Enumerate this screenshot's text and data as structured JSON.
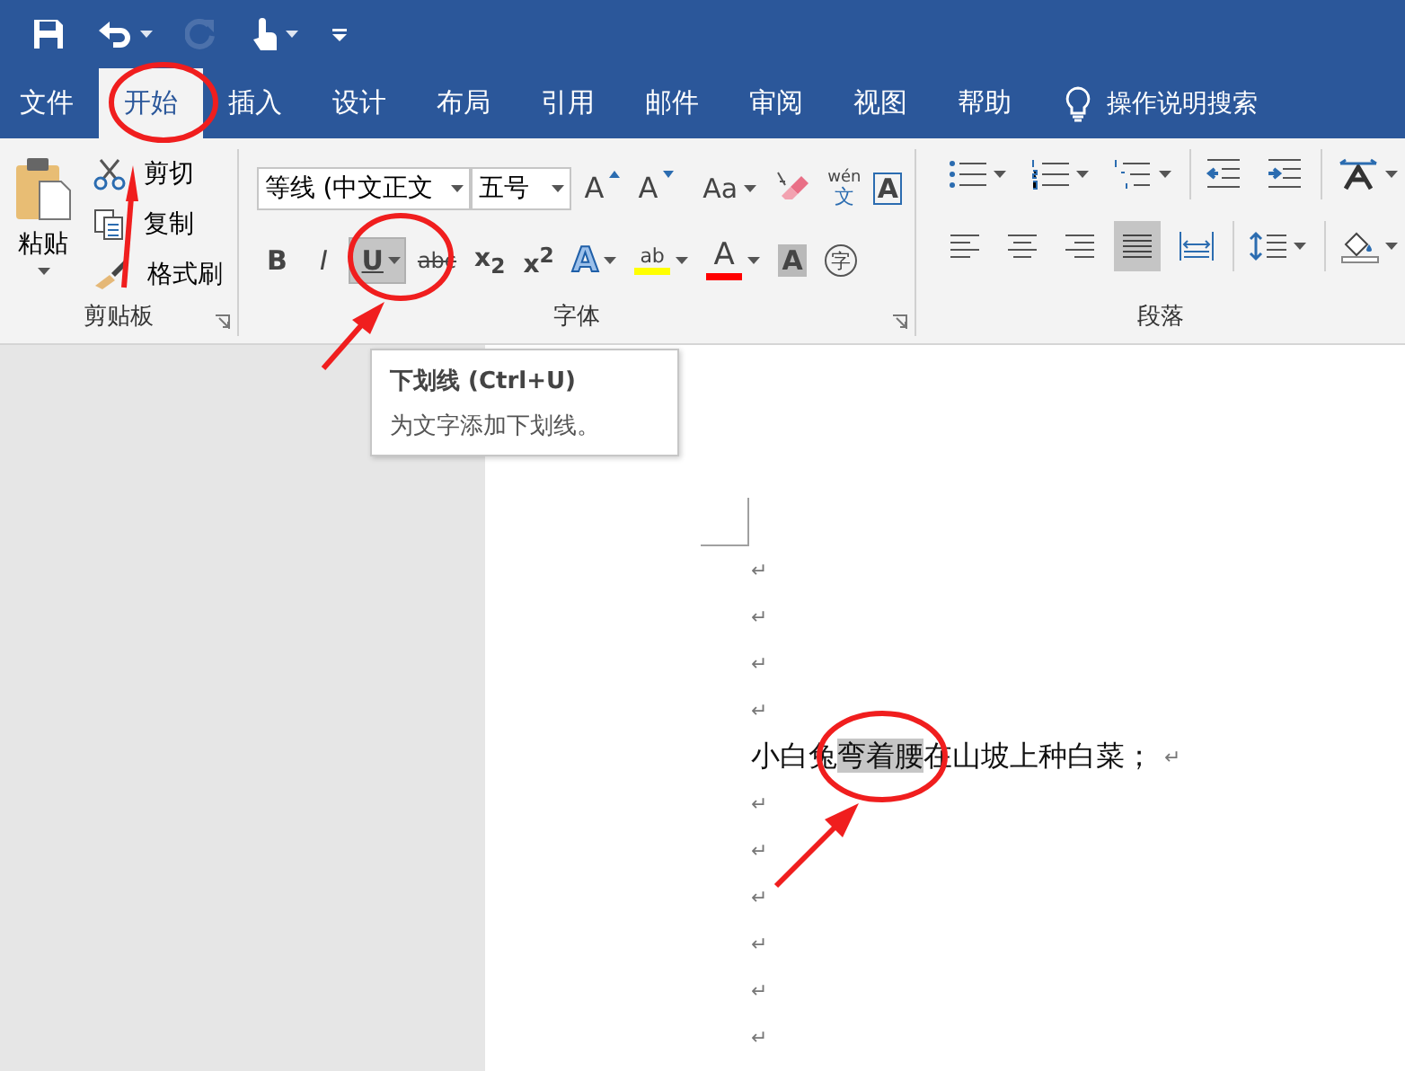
{
  "quick_access": [
    {
      "kind": "save",
      "disabled": false,
      "dropdown": false
    },
    {
      "kind": "undo",
      "disabled": false,
      "dropdown": true
    },
    {
      "kind": "redo",
      "disabled": true,
      "dropdown": false
    },
    {
      "kind": "touch",
      "disabled": false,
      "dropdown": true
    },
    {
      "kind": "customize",
      "disabled": false,
      "dropdown": false
    }
  ],
  "tabs": [
    {
      "label": "文件",
      "selected": false
    },
    {
      "label": "开始",
      "selected": true
    },
    {
      "label": "插入",
      "selected": false
    },
    {
      "label": "设计",
      "selected": false
    },
    {
      "label": "布局",
      "selected": false
    },
    {
      "label": "引用",
      "selected": false
    },
    {
      "label": "邮件",
      "selected": false
    },
    {
      "label": "审阅",
      "selected": false
    },
    {
      "label": "视图",
      "selected": false
    },
    {
      "label": "帮助",
      "selected": false
    }
  ],
  "tell_me": {
    "label": "操作说明搜索"
  },
  "clipboard": {
    "paste": "粘贴",
    "label": "剪贴板",
    "items": [
      {
        "kind": "cut",
        "label": "剪切"
      },
      {
        "kind": "copy",
        "label": "复制"
      },
      {
        "kind": "format-painter",
        "label": "格式刷"
      }
    ]
  },
  "font": {
    "font_name": "等线 (中文正文",
    "font_size": "五号",
    "label": "字体",
    "row1": [
      {
        "kind": "grow",
        "label": "A"
      },
      {
        "kind": "shrink",
        "label": "A"
      },
      {
        "kind": "case",
        "label": "Aa"
      },
      {
        "kind": "clear"
      },
      {
        "kind": "phonetic",
        "label": "wén",
        "sub": "文"
      },
      {
        "kind": "border",
        "label": "A"
      }
    ],
    "row2": [
      {
        "kind": "bold",
        "label": "B",
        "selected": false,
        "dropdown": false
      },
      {
        "kind": "italic",
        "label": "I",
        "selected": false,
        "dropdown": false
      },
      {
        "kind": "underline",
        "label": "U",
        "selected": true,
        "dropdown": true
      },
      {
        "kind": "strike",
        "label": "abc",
        "selected": false,
        "dropdown": false
      },
      {
        "kind": "subscript",
        "label": "x$_{2}$",
        "selected": false,
        "dropdown": false
      },
      {
        "kind": "superscript",
        "label": "x$^{2}$",
        "selected": false,
        "dropdown": false
      },
      {
        "kind": "effects",
        "label": "A",
        "selected": false,
        "dropdown": true
      },
      {
        "kind": "highlight",
        "label": "ab",
        "color": "#ffff00",
        "selected": false,
        "dropdown": true
      },
      {
        "kind": "font-color",
        "label": "A",
        "color": "#ff0000",
        "selected": false,
        "dropdown": true
      },
      {
        "kind": "shading",
        "label": "A",
        "selected": false,
        "dropdown": false
      },
      {
        "kind": "enclose",
        "label": "字",
        "selected": false,
        "dropdown": false
      }
    ]
  },
  "paragraph": {
    "label": "段落",
    "row1": [
      {
        "kind": "bullets",
        "dropdown": true
      },
      {
        "kind": "numbering",
        "dropdown": true
      },
      {
        "kind": "multilevel",
        "dropdown": true
      },
      {
        "kind": "outdent",
        "dropdown": false
      },
      {
        "kind": "indent",
        "dropdown": false
      },
      {
        "kind": "asian-layout",
        "dropdown": true
      }
    ],
    "row2": [
      {
        "kind": "align-left",
        "selected": false,
        "dropdown": false
      },
      {
        "kind": "align-center",
        "selected": false,
        "dropdown": false
      },
      {
        "kind": "align-right",
        "selected": false,
        "dropdown": false
      },
      {
        "kind": "justify",
        "selected": true,
        "dropdown": false
      },
      {
        "kind": "distributed",
        "selected": false,
        "dropdown": false
      },
      {
        "kind": "line-spacing",
        "selected": false,
        "dropdown": true
      },
      {
        "kind": "shading",
        "selected": false,
        "dropdown": true
      }
    ]
  },
  "tooltip": {
    "title": "下划线 (Ctrl+U)",
    "text": "为文字添加下划线。"
  },
  "document": {
    "paragraphs": [
      {
        "mark": "↵"
      },
      {
        "mark": "↵"
      },
      {
        "mark": "↵"
      },
      {
        "mark": "↵"
      },
      {
        "segments": [
          {
            "text": "小白兔",
            "selected": false
          },
          {
            "text": "弯着腰",
            "selected": true
          },
          {
            "text": "在山坡上种白菜；",
            "selected": false
          }
        ],
        "mark": "↵"
      },
      {
        "mark": "↵"
      },
      {
        "mark": "↵"
      },
      {
        "mark": "↵"
      },
      {
        "mark": "↵"
      },
      {
        "mark": "↵"
      },
      {
        "mark": "↵"
      }
    ]
  }
}
